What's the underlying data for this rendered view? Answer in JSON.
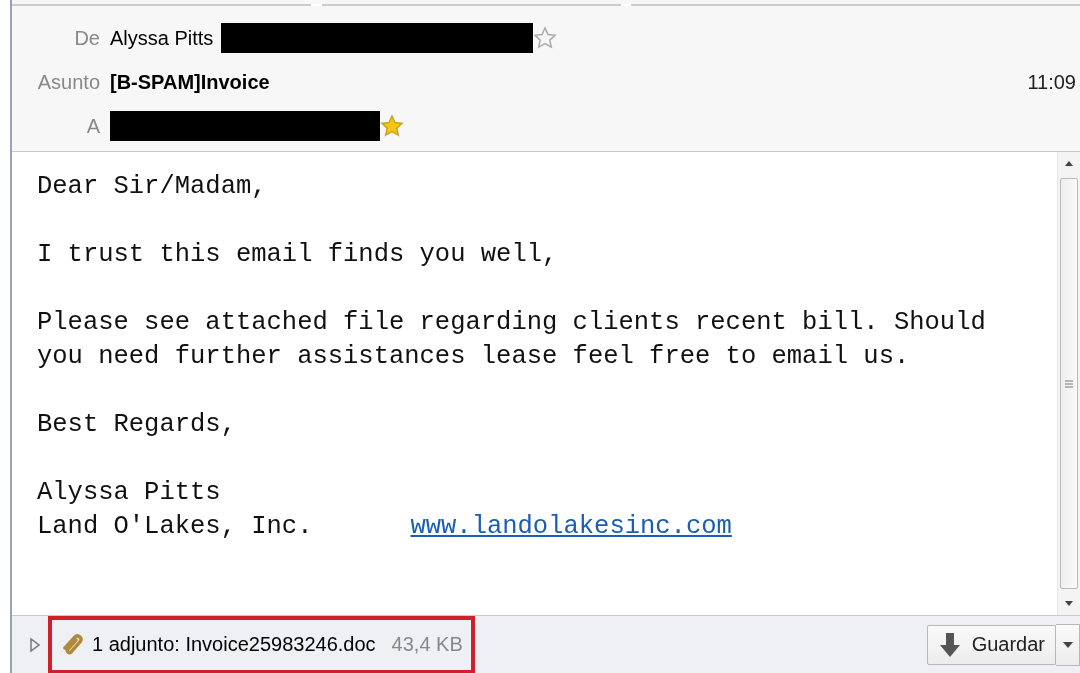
{
  "header": {
    "fields": [
      {
        "label": "De",
        "value": "Alyssa Pitts",
        "redacted": true,
        "starred": false
      },
      {
        "label": "Asunto",
        "value": "[B-SPAM]Invoice",
        "time": "11:09"
      },
      {
        "label": "A",
        "redacted": true,
        "starred": true
      }
    ]
  },
  "body": {
    "paragraphs": [
      {
        "lines": [
          {
            "text": "Dear Sir/Madam,"
          }
        ]
      },
      {
        "lines": [
          {
            "text": "I trust this email finds you well,"
          }
        ]
      },
      {
        "lines": [
          {
            "text": "Please see attached file regarding clients recent bill. Should"
          },
          {
            "text": "you need further assistances lease feel free to email us."
          }
        ]
      },
      {
        "lines": [
          {
            "text": "Best Regards,"
          }
        ]
      },
      {
        "lines": [
          {
            "text": "Alyssa Pitts"
          },
          {
            "text": "Land O'Lakes, Inc.",
            "link": "www.landolakesinc.com"
          }
        ]
      }
    ]
  },
  "attachments": {
    "expanded": false,
    "highlighted": true,
    "summary": "1 adjunto: Invoice25983246.doc",
    "size": "43,4 KB",
    "save_button": "Guardar"
  }
}
